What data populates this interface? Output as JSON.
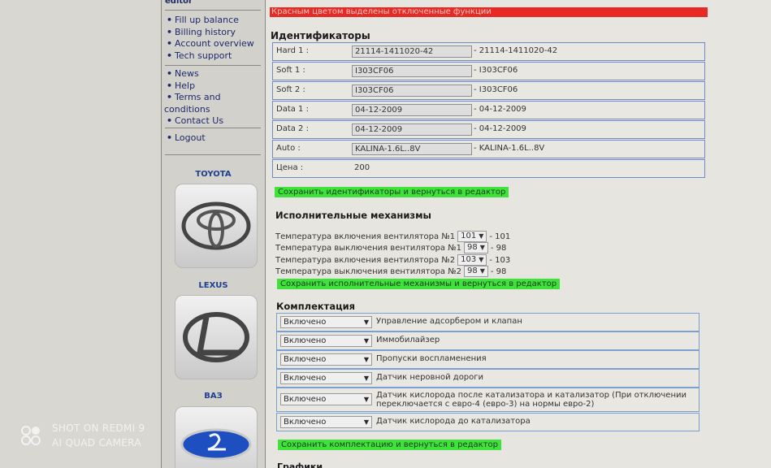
{
  "sidebar": {
    "editor_label": "editor",
    "menu1": [
      "Fill up balance",
      "Billing history",
      "Account overview",
      "Tech support"
    ],
    "menu2": [
      "News",
      "Help",
      "Terms and",
      "conditions",
      "Contact Us"
    ],
    "menu3": [
      "Logout"
    ],
    "brands": [
      "TOYOTA",
      "LEXUS",
      "ВАЗ"
    ]
  },
  "notice": "Красным цветом выделены отключенные функции",
  "identifiers": {
    "title": "Идентификаторы",
    "rows": [
      {
        "label": "Hard 1 :",
        "input": "21114-1411020-42",
        "value": "- 21114-1411020-42"
      },
      {
        "label": "Soft 1 :",
        "input": "I303CF06",
        "value": "- I303CF06"
      },
      {
        "label": "Soft 2 :",
        "input": "I303CF06",
        "value": "- I303CF06"
      },
      {
        "label": "Data 1 :",
        "input": "04-12-2009",
        "value": "- 04-12-2009"
      },
      {
        "label": "Data 2 :",
        "input": "04-12-2009",
        "value": "- 04-12-2009"
      },
      {
        "label": "Auto :",
        "input": "KALINA-1.6L..8V",
        "value": "- KALINA-1.6L..8V"
      }
    ],
    "price_label": "Цена :",
    "price_value": "200",
    "save_label": "Сохранить  идентификаторы  и вернуться в редактор"
  },
  "mechanisms": {
    "title": "Исполнительные механизмы",
    "rows": [
      {
        "label": "Температура включения вентилятора №1",
        "selected": "101",
        "value": "- 101"
      },
      {
        "label": "Температура выключения вентилятора №1",
        "selected": "98",
        "value": "- 98"
      },
      {
        "label": "Температура включения вентилятора №2",
        "selected": "103",
        "value": "- 103"
      },
      {
        "label": "Температура выключения вентилятора №2",
        "selected": "98",
        "value": "- 98"
      }
    ],
    "save_label": "Сохранить  исполнительные механизмы  и вернуться в редактор"
  },
  "equipment": {
    "title": "Комплектация",
    "rows": [
      {
        "selected": "Включено",
        "desc": "Управление адсорбером и клапан"
      },
      {
        "selected": "Включено",
        "desc": "Иммобилайзер"
      },
      {
        "selected": "Включено",
        "desc": "Пропуски воспламенения"
      },
      {
        "selected": "Включено",
        "desc": "Датчик неровной дороги"
      },
      {
        "selected": "Включено",
        "desc": "Датчик кислорода после катализатора и катализатор (При отключении",
        "desc2": "переключается с евро-4 (евро-3) на нормы евро-2)"
      },
      {
        "selected": "Включено",
        "desc": "Датчик кислорода до катализатора"
      }
    ],
    "save_label": "Сохранить  комплектацию  и вернуться в редактор"
  },
  "next_section": "Графики",
  "watermark": {
    "line1": "SHOT ON REDMI 9",
    "line2": "AI QUAD CAMERA"
  }
}
